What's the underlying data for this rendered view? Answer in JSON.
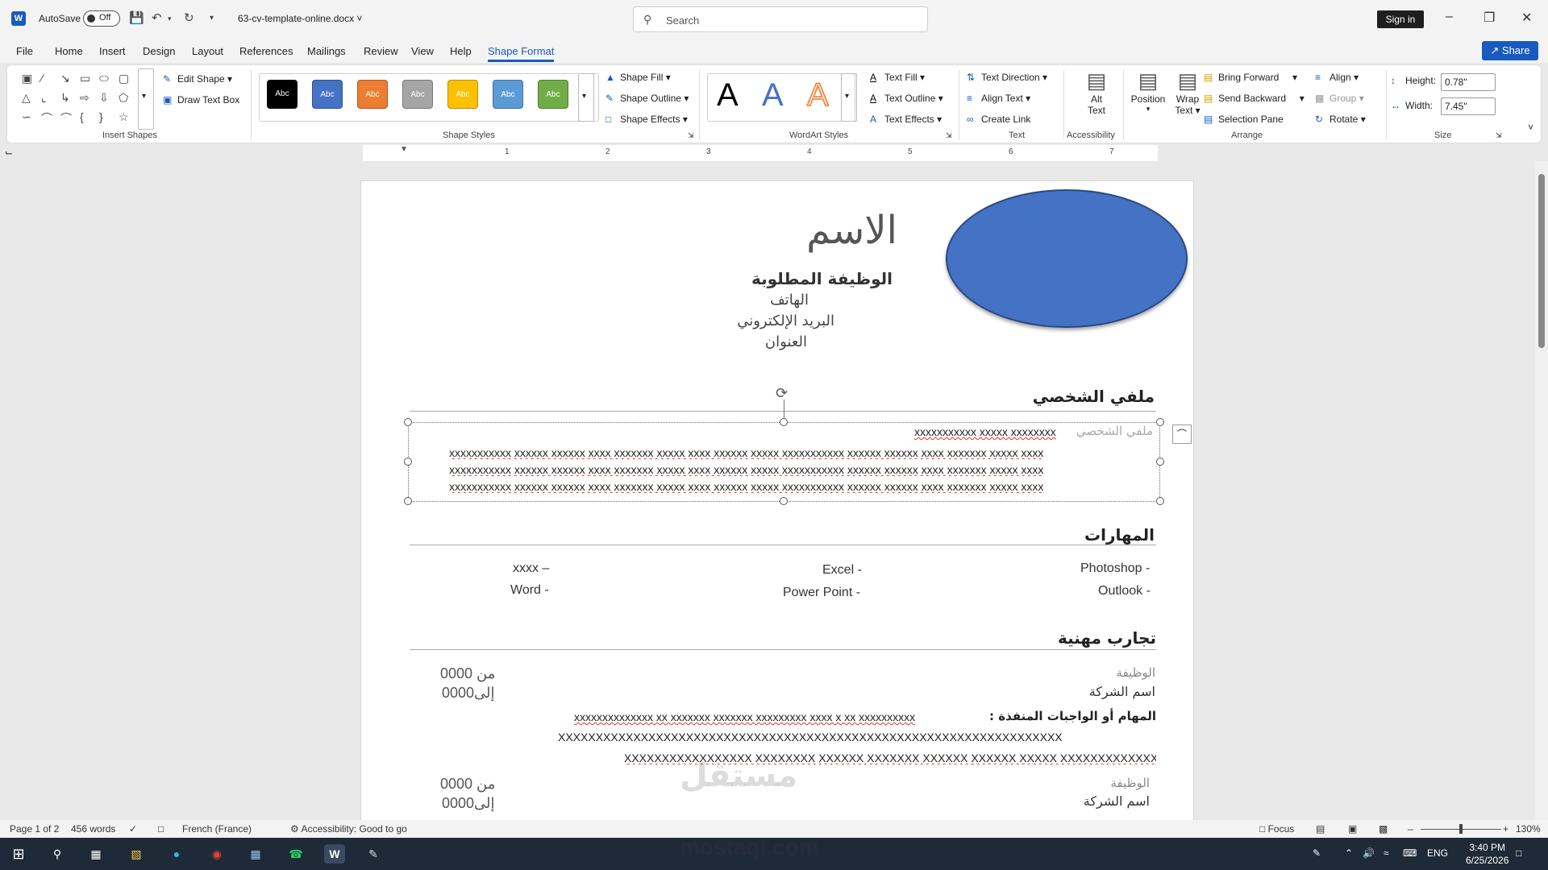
{
  "titlebar": {
    "autosave_label": "AutoSave",
    "autosave_state": "Off",
    "doc_title": "63-cv-template-online.docx",
    "search_placeholder": "Search",
    "signin": "Sign in"
  },
  "menu": {
    "tabs": [
      "File",
      "Home",
      "Insert",
      "Design",
      "Layout",
      "References",
      "Mailings",
      "Review",
      "View",
      "Help",
      "Shape Format"
    ],
    "active": "Shape Format",
    "share": "Share"
  },
  "ribbon": {
    "insert_shapes": {
      "label": "Insert Shapes",
      "edit_shape": "Edit Shape",
      "draw_text_box": "Draw Text Box"
    },
    "shape_styles": {
      "label": "Shape Styles",
      "swatch_text": "Abc",
      "shape_fill": "Shape Fill",
      "shape_outline": "Shape Outline",
      "shape_effects": "Shape Effects",
      "swatch_colors": [
        "#000000",
        "#4472c4",
        "#ed7d31",
        "#a5a5a5",
        "#ffc000",
        "#5b9bd5",
        "#70ad47"
      ]
    },
    "wordart": {
      "label": "WordArt Styles",
      "letter": "A",
      "text_fill": "Text Fill",
      "text_outline": "Text Outline",
      "text_effects": "Text Effects"
    },
    "text": {
      "label": "Text",
      "text_direction": "Text Direction",
      "align_text": "Align Text",
      "create_link": "Create Link"
    },
    "accessibility": {
      "label": "Accessibility",
      "alt_text_1": "Alt",
      "alt_text_2": "Text"
    },
    "arrange": {
      "label": "Arrange",
      "position": "Position",
      "wrap_1": "Wrap",
      "wrap_2": "Text",
      "bring_forward": "Bring Forward",
      "send_backward": "Send Backward",
      "selection_pane": "Selection Pane",
      "align": "Align",
      "group": "Group",
      "rotate": "Rotate"
    },
    "size": {
      "label": "Size",
      "height_label": "Height:",
      "height_value": "0.78\"",
      "width_label": "Width:",
      "width_value": "7.45\""
    }
  },
  "ruler": {
    "numbers": [
      "1",
      "2",
      "3",
      "4",
      "5",
      "6",
      "7"
    ]
  },
  "document": {
    "name": "الاسم",
    "job_title": "الوظيفة المطلوبة",
    "phone": "الهاتف",
    "email": "البريد الإلكتروني",
    "address": "العنوان",
    "profile_heading": "ملفي الشخصي",
    "profile_placeholder": "ملفي الشخصي",
    "profile_line0": "xxxxxxxxxxx xxxxx xxxxxxxx",
    "profile_line1": "xxxxxxxxxxx xxxxxx xxxxxx xxxx xxxxxxx xxxxx xxxx xxxxxx xxxxx xxxxxxxxxxx xxxxxx xxxxxx xxxx xxxxxxx xxxxx xxxx",
    "profile_line2": "xxxxxxxxxxx xxxxxx xxxxxx xxxx xxxxxxx xxxxx xxxx xxxxxx xxxxx xxxxxxxxxxx xxxxxx xxxxxx xxxx xxxxxxx xxxxx xxxx",
    "profile_line3": "xxxxxxxxxxx xxxxxx xxxxxx xxxx xxxxxxx xxxxx xxxx xxxxxx xxxxx xxxxxxxxxxx xxxxxx xxxxxx xxxx xxxxxxx xxxxx xxxx",
    "skills_heading": "المهارات",
    "skills": {
      "photoshop": "Photoshop -",
      "outlook": "Outlook -",
      "excel": "Excel -",
      "powerpoint": "Power Point -",
      "xxxx": "xxxx –",
      "word": "Word -"
    },
    "experience_heading": "تجارب مهنية",
    "exp1": {
      "job": "الوظيفة",
      "company": "اسم الشركة",
      "from": "من 0000",
      "to": "إلى0000",
      "tasks_label": "المهام أو الواجبات المنفذة :",
      "tasks_line1": "xxxxxxxxxxxxxx xx xxxxxxx xxxxxxx xxxxxxxxx xxxx x xx xxxxxxxxxx",
      "tasks_line2": "XXXXXXXXXXXXXXXXXXXXXXXXXXXXXXXXXXXXXXXXXXXXXXXXXXXXXXXXXXXXXXXXXXX",
      "tasks_line3": "XXXXXXXXXXXXXXXXX XXXXXXXX XXXXXX XXXXXXX XXXXXX XXXXXX XXXXX XXXXXXXXXXXXX"
    },
    "exp2": {
      "job": "الوظيفة",
      "company": "اسم الشركة",
      "from": "من 0000",
      "to": "إلى0000"
    },
    "watermark": "مستقل",
    "watermark_url": "mostaql.com"
  },
  "status": {
    "page": "Page 1 of 2",
    "words": "456 words",
    "language": "French (France)",
    "accessibility": "Accessibility: Good to go",
    "focus": "Focus",
    "zoom": "130%"
  },
  "taskbar": {
    "lang": "ENG",
    "time": "3:40 PM",
    "date": "6/25/2026"
  }
}
